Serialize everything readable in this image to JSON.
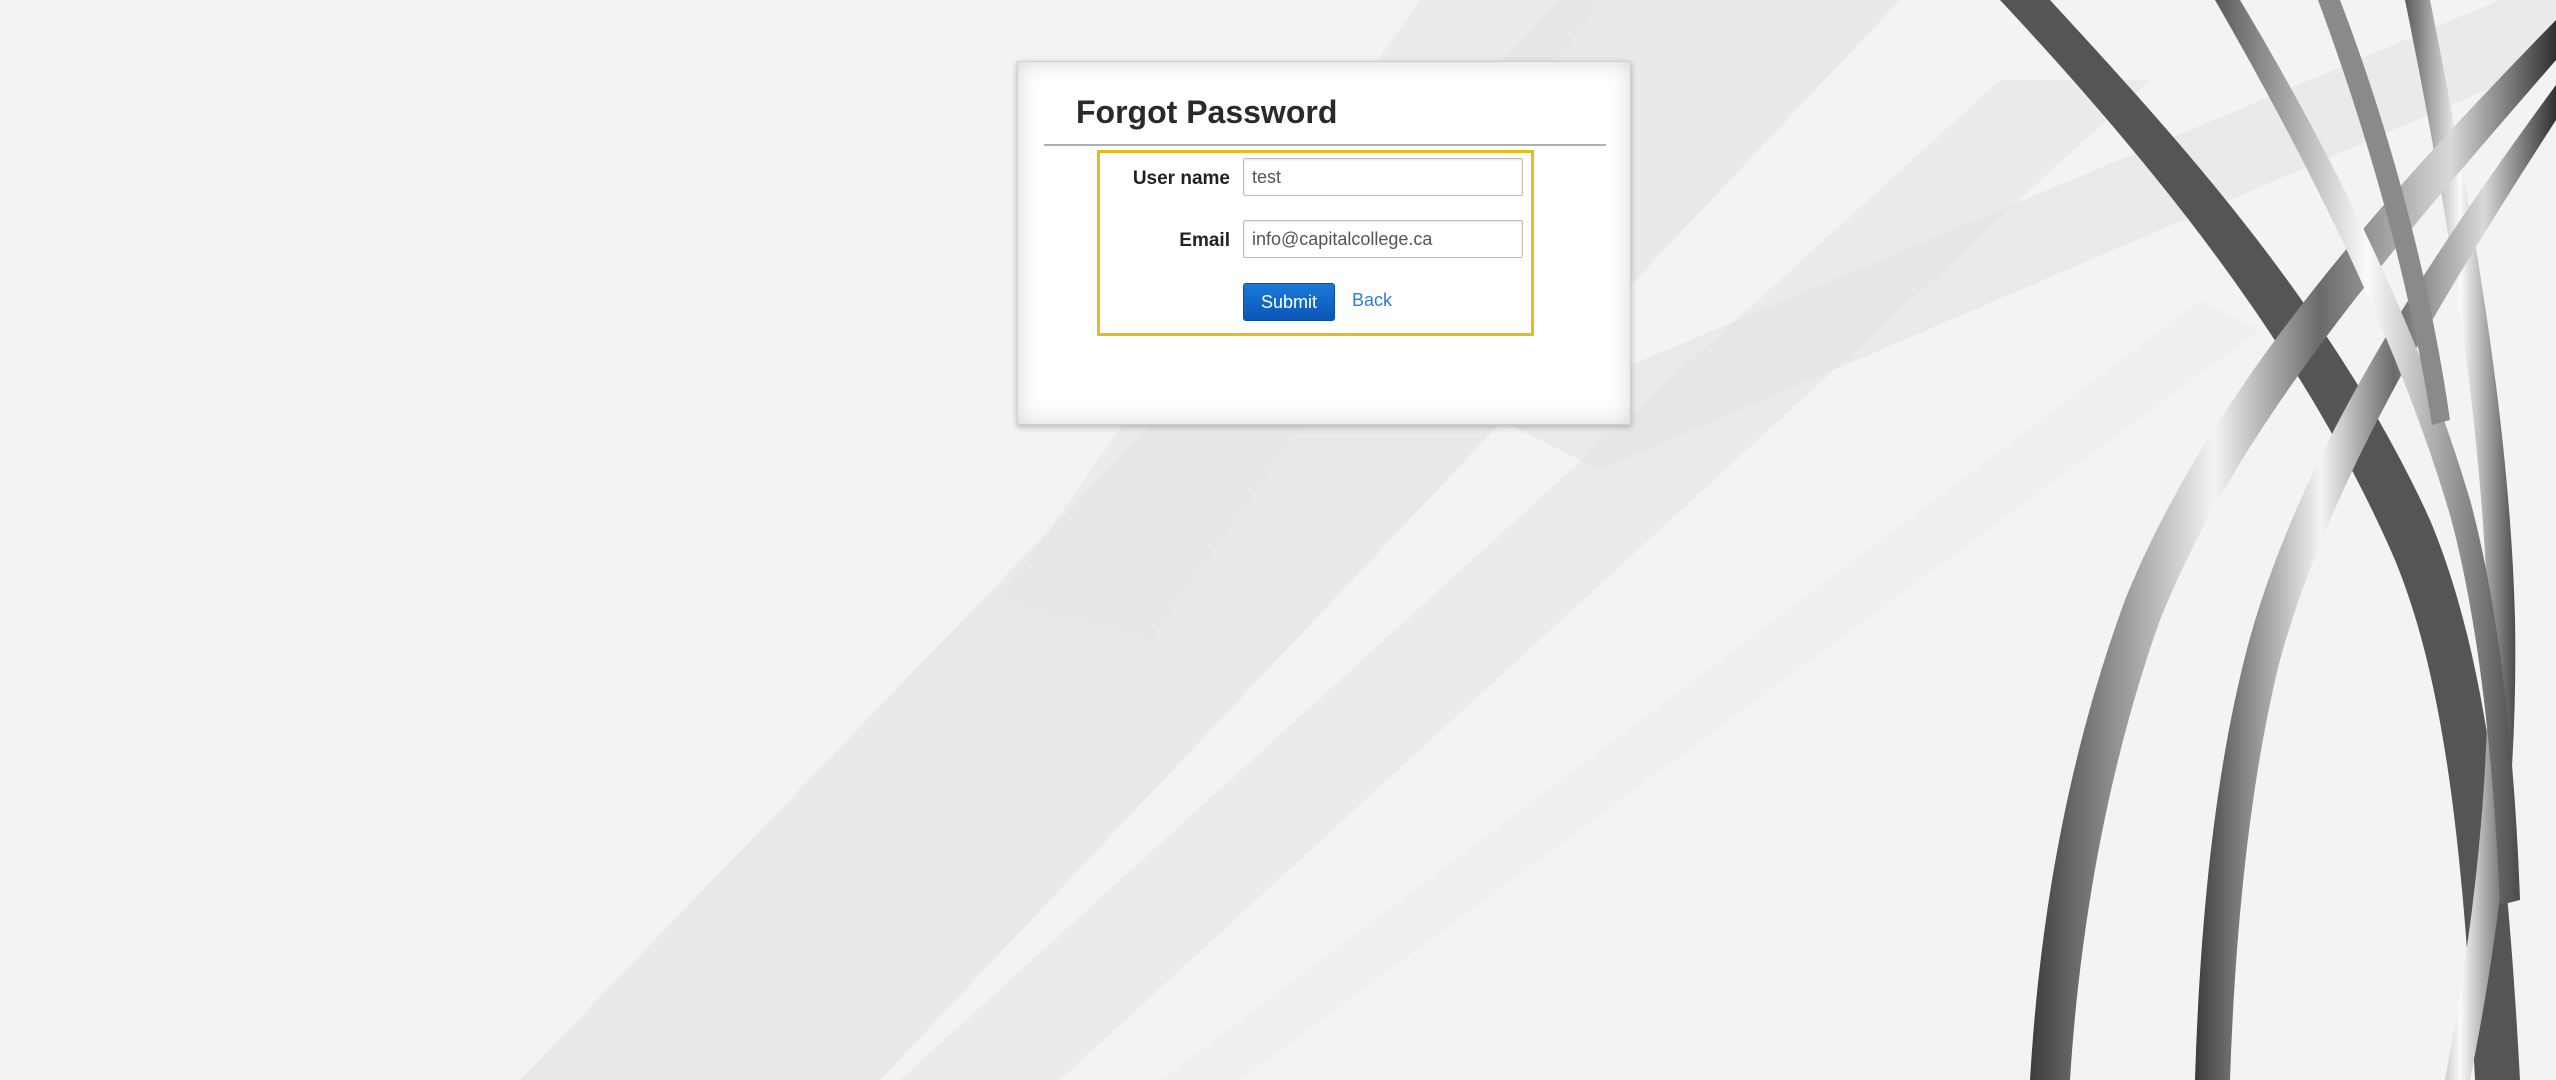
{
  "page": {
    "title": "Forgot Password",
    "highlight_color": "#e6be1c",
    "accent_color": "#0b62c4"
  },
  "form": {
    "username_label": "User name",
    "username_value": "test",
    "email_label": "Email",
    "email_value": "info@capitalcollege.ca",
    "submit_label": "Submit",
    "back_label": "Back"
  }
}
